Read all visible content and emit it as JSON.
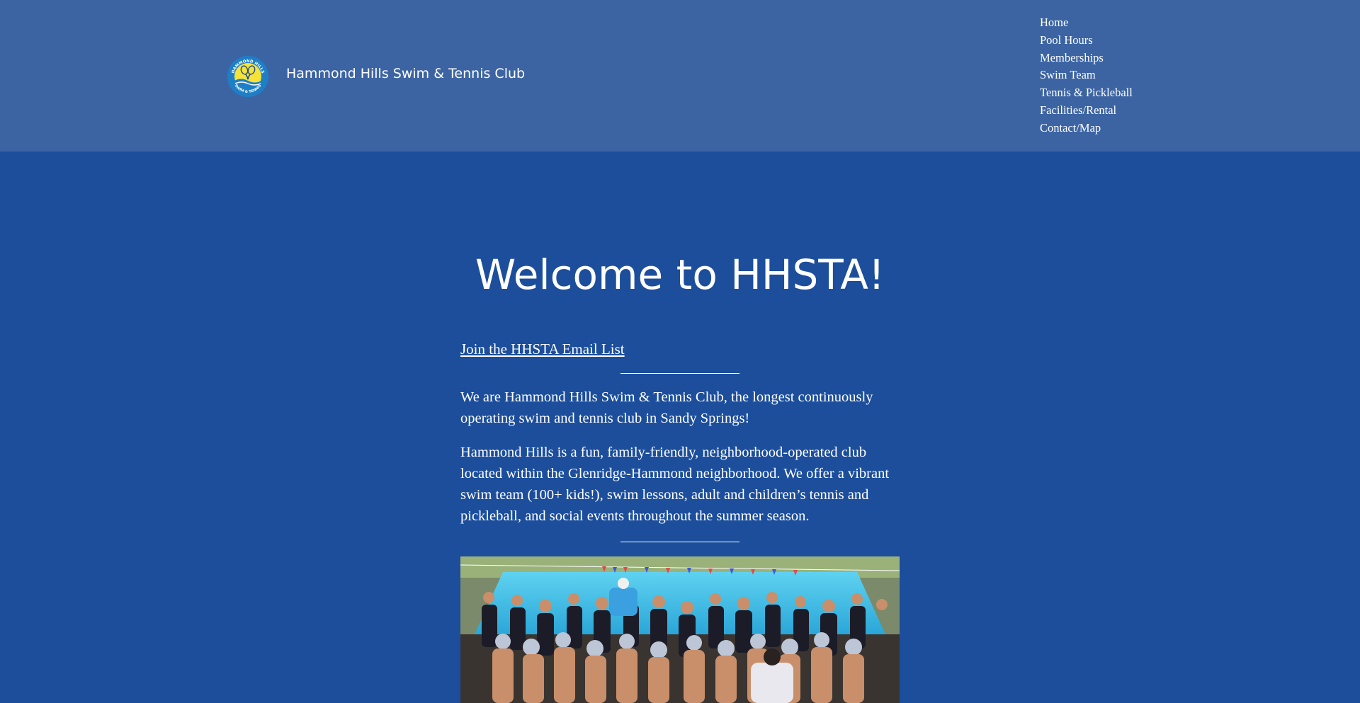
{
  "header": {
    "site_title": "Hammond Hills Swim & Tennis Club",
    "logo": {
      "top_text": "HAMMOND HILLS",
      "bottom_text": "SWIM & TENNIS"
    },
    "nav": [
      {
        "label": "Home"
      },
      {
        "label": "Pool Hours"
      },
      {
        "label": "Memberships"
      },
      {
        "label": "Swim Team"
      },
      {
        "label": "Tennis & Pickleball"
      },
      {
        "label": "Facilities/Rental"
      },
      {
        "label": "Contact/Map"
      }
    ]
  },
  "main": {
    "title": "Welcome to HHSTA!",
    "email_link": "Join the HHSTA Email List",
    "paragraphs": [
      "We are Hammond Hills Swim & Tennis Club, the longest continuously operating swim and tennis club in Sandy Springs!",
      "Hammond Hills is a fun, family-friendly, neighborhood-operated club located within the Glenridge-Hammond neighborhood. We offer a vibrant swim team (100+ kids!), swim lessons, adult and children’s tennis and pickleball, and social events throughout the summer season."
    ]
  },
  "colors": {
    "page_background": "#1c4e9c",
    "header_background": "#3c64a3",
    "text": "#ffffff",
    "logo_yellow": "#f6e33a",
    "logo_blue": "#1e7fc6"
  },
  "icons": {
    "logo": "club-logo-icon",
    "photo": "swim-team-photo"
  }
}
